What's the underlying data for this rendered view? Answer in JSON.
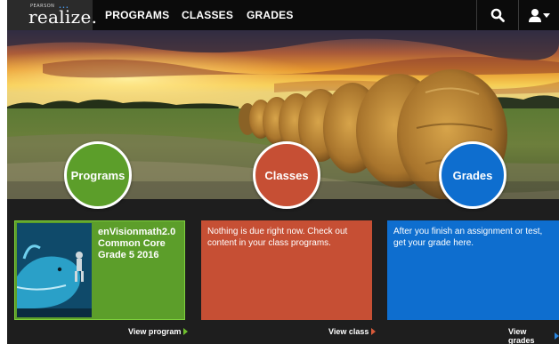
{
  "brand": {
    "pearson": "PEARSON",
    "name": "realize."
  },
  "nav": {
    "programs": "PROGRAMS",
    "classes": "CLASSES",
    "grades": "GRADES"
  },
  "icons": {
    "search": "search-icon",
    "user_menu": "user-icon",
    "dropdown": "caret-down-icon"
  },
  "hero_buttons": {
    "programs": "Programs",
    "classes": "Classes",
    "grades": "Grades"
  },
  "cards": {
    "program": {
      "title": "enVisionmath2.0 Common Core Grade 5 2016",
      "link": "View program"
    },
    "class": {
      "text": "Nothing is due right now. Check out content in your class programs.",
      "link": "View class"
    },
    "grades": {
      "text": "After you finish an assignment or test, get your grade here.",
      "link": "View grades"
    }
  },
  "colors": {
    "green": "#5c9e2a",
    "red": "#c64f34",
    "blue": "#0e6ecf",
    "background": "#1e1e1e"
  }
}
